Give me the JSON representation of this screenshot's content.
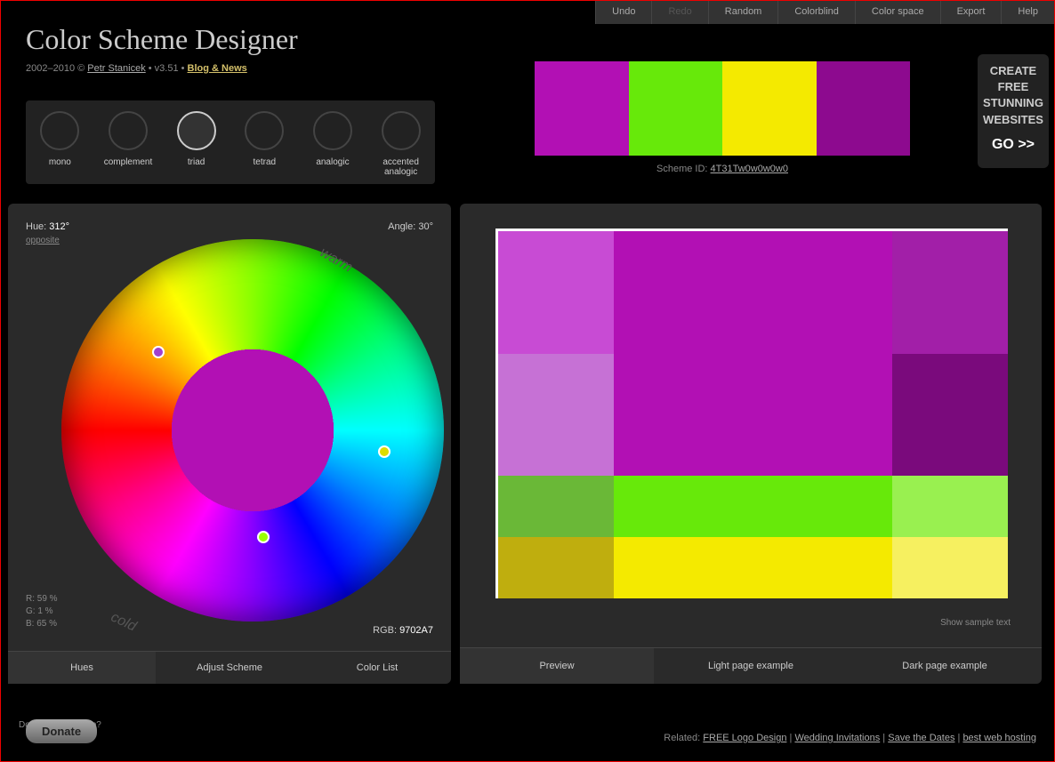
{
  "topmenu": [
    "Undo",
    "Redo",
    "Random",
    "Colorblind",
    "Color space",
    "Export",
    "Help"
  ],
  "header": {
    "title": "Color Scheme Designer",
    "copyright": "2002–2010 © ",
    "author": "Petr Stanicek",
    "version": " • v3.51 • ",
    "blog": "Blog & News"
  },
  "schemes": [
    {
      "label": "mono"
    },
    {
      "label": "complement"
    },
    {
      "label": "triad"
    },
    {
      "label": "tetrad"
    },
    {
      "label": "analogic"
    },
    {
      "label": "accented analogic"
    }
  ],
  "preview_strip": [
    "#b210b4",
    "#67e90a",
    "#f4ea00",
    "#8d0a8f"
  ],
  "scheme_id": {
    "label": "Scheme ID: ",
    "value": "4T31Tw0w0w0w0"
  },
  "promo": {
    "l1": "CREATE",
    "l2": "FREE",
    "l3": "STUNNING",
    "l4": "WEBSITES",
    "go": "GO >>"
  },
  "hue": {
    "label": "Hue: ",
    "value": "312°"
  },
  "angle": {
    "label": "Angle: ",
    "value": "30°"
  },
  "opposite": "opposite",
  "wheel_labels": {
    "warm": "warm",
    "cold": "cold"
  },
  "rgb": {
    "r": "R: 59 %",
    "g": "G:   1 %",
    "b": "B: 65 %",
    "hex_label": "RGB: ",
    "hex": "9702A7"
  },
  "left_tabs": [
    "Hues",
    "Adjust Scheme",
    "Color List"
  ],
  "swatches": [
    [
      "#c84bd4",
      "#b210b4",
      "#a21fa8"
    ],
    [
      "#c671d5",
      "#b210b4",
      "#7a0a7c"
    ],
    [
      "#6ab837",
      "#67e90a",
      "#99f050"
    ],
    [
      "#4c8a0f",
      "#67e90a",
      "#b0f285"
    ],
    [
      "#bfae0e",
      "#f4ea00",
      "#f6f060"
    ],
    [
      "#8a7c05",
      "#f4ea00",
      "#faf49a"
    ]
  ],
  "sample_text": "Show sample text",
  "right_tabs": [
    "Preview",
    "Light page example",
    "Dark page example"
  ],
  "footer_like": "Do you like this app?",
  "donate": "Donate",
  "footer_related": {
    "label": "Related: ",
    "links": [
      "FREE Logo Design",
      "Wedding Invitations",
      "Save the Dates",
      "best web hosting"
    ]
  }
}
